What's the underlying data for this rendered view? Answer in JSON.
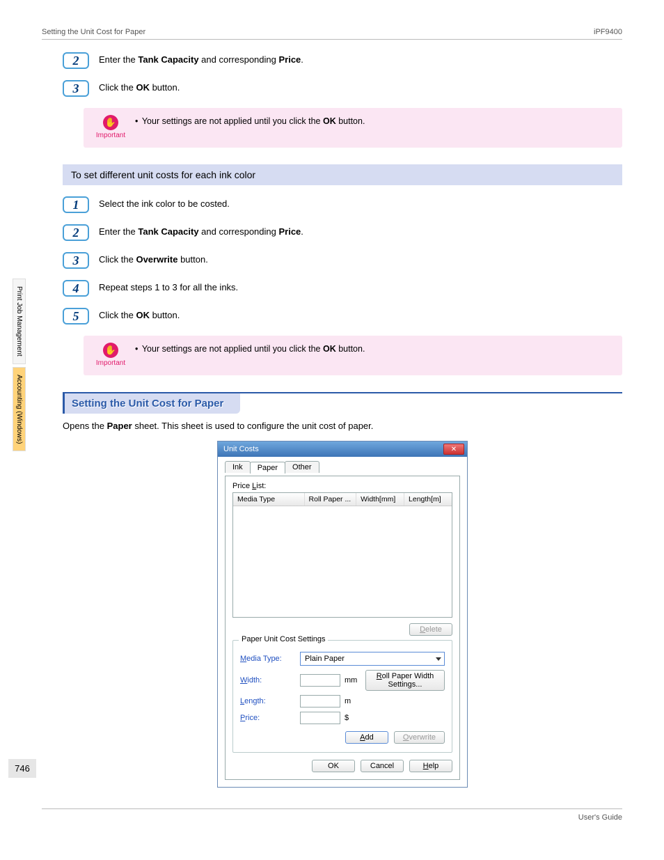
{
  "header": {
    "left": "Setting the Unit Cost for Paper",
    "right": "iPF9400"
  },
  "side": {
    "tab1": "Print Job Management",
    "tab2": "Accounting (Windows)"
  },
  "page_number": "746",
  "pre_steps": {
    "s2": {
      "num": "2",
      "text_before": "Enter the ",
      "b1": "Tank Capacity",
      "mid": " and corresponding ",
      "b2": "Price",
      "after": "."
    },
    "s3": {
      "num": "3",
      "text_before": "Click the ",
      "b1": "OK",
      "after": " button."
    }
  },
  "note1": {
    "label": "Important",
    "text_before": "Your settings are not applied until you click the ",
    "b1": "OK",
    "after": " button."
  },
  "subheading": "To set different unit costs for each ink color",
  "steps": {
    "s1": {
      "num": "1",
      "text": "Select the ink color to be costed."
    },
    "s2": {
      "num": "2",
      "text_before": "Enter the ",
      "b1": "Tank Capacity",
      "mid": " and corresponding ",
      "b2": "Price",
      "after": "."
    },
    "s3": {
      "num": "3",
      "text_before": "Click the ",
      "b1": "Overwrite",
      "after": " button."
    },
    "s4": {
      "num": "4",
      "text": "Repeat steps 1 to 3 for all the inks."
    },
    "s5": {
      "num": "5",
      "text_before": "Click the ",
      "b1": "OK",
      "after": " button."
    }
  },
  "note2": {
    "label": "Important",
    "text_before": "Your settings are not applied until you click the ",
    "b1": "OK",
    "after": " button."
  },
  "section": {
    "title": "Setting the Unit Cost for Paper",
    "desc_before": "Opens the ",
    "desc_b": "Paper",
    "desc_after": " sheet. This sheet is used to configure the unit cost of paper."
  },
  "dialog": {
    "title": "Unit Costs",
    "tabs": {
      "t1": "Ink",
      "t2": "Paper",
      "t3": "Other"
    },
    "price_list_label_pre": "Price ",
    "price_list_label_ul": "L",
    "price_list_label_post": "ist:",
    "cols": {
      "c1": "Media Type",
      "c2": "Roll Paper ...",
      "c3": "Width[mm]",
      "c4": "Length[m]"
    },
    "delete_pre": "",
    "delete_ul": "D",
    "delete_post": "elete",
    "fieldset_legend": "Paper Unit Cost Settings",
    "media_label_ul": "M",
    "media_label_post": "edia Type:",
    "media_value": "Plain Paper",
    "width_label_ul": "W",
    "width_label_post": "idth:",
    "width_unit": "mm",
    "roll_btn_ul": "R",
    "roll_btn_post": "oll Paper Width Settings...",
    "length_label_ul": "L",
    "length_label_post": "ength:",
    "length_unit": "m",
    "price_label_ul": "P",
    "price_label_post": "rice:",
    "price_unit": "$",
    "add_ul": "A",
    "add_post": "dd",
    "over_ul": "O",
    "over_post": "verwrite",
    "ok": "OK",
    "cancel": "Cancel",
    "help_ul": "H",
    "help_post": "elp"
  },
  "footer": {
    "right": "User's Guide"
  }
}
